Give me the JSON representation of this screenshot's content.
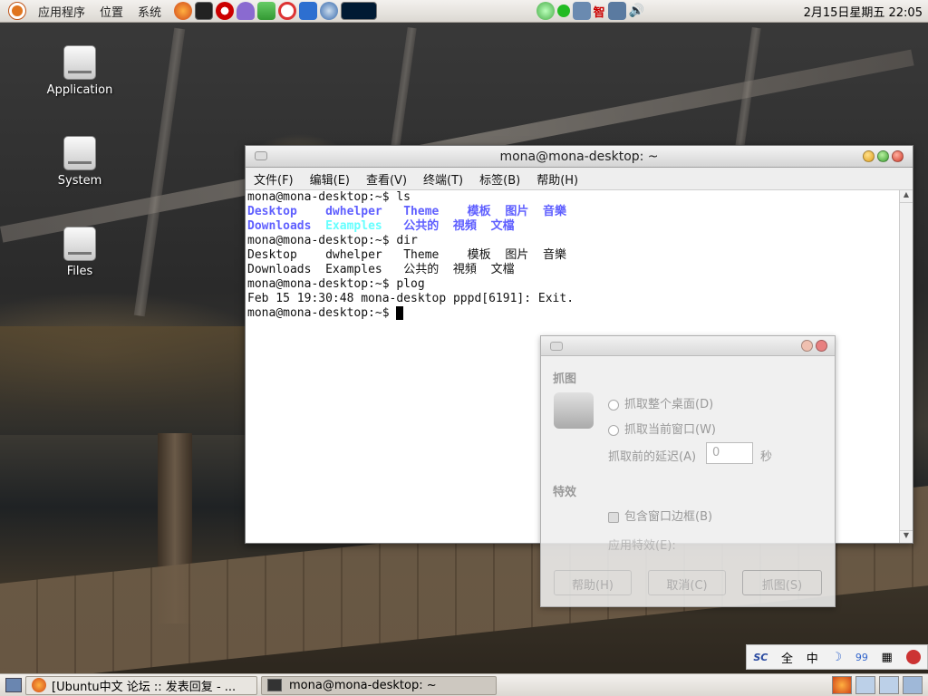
{
  "topbar": {
    "menus": [
      "应用程序",
      "位置",
      "系统"
    ],
    "clock": "2月15日星期五 22:05",
    "zhi_label": "智"
  },
  "desktop_icons": [
    "Application",
    "System",
    "Files"
  ],
  "terminal": {
    "title": "mona@mona-desktop: ~",
    "menus": [
      "文件(F)",
      "编辑(E)",
      "查看(V)",
      "终端(T)",
      "标签(B)",
      "帮助(H)"
    ],
    "lines": {
      "prompt1": "mona@mona-desktop:~$ ls",
      "ls1": [
        "Desktop",
        "dwhelper",
        "Theme",
        "模板",
        "图片",
        "音樂"
      ],
      "ls2": [
        "Downloads",
        "Examples",
        "公共的",
        "視頻",
        "文檔"
      ],
      "prompt2": "mona@mona-desktop:~$ dir",
      "dir1": [
        "Desktop",
        "dwhelper",
        "Theme",
        "模板",
        "图片",
        "音樂"
      ],
      "dir2": [
        "Downloads",
        "Examples",
        "公共的",
        "視頻",
        "文檔"
      ],
      "prompt3": "mona@mona-desktop:~$ plog",
      "log": "Feb 15 19:30:48 mona-desktop pppd[6191]: Exit.",
      "prompt4": "mona@mona-desktop:~$ "
    }
  },
  "screenshot_dialog": {
    "section_grab": "抓图",
    "opt_desktop": "抓取整个桌面(D)",
    "opt_window": "抓取当前窗口(W)",
    "delay_label": "抓取前的延迟(A)",
    "delay_value": "0",
    "delay_unit": "秒",
    "section_effects": "特效",
    "border_label": "包含窗口边框(B)",
    "apply_label": "应用特效(E):",
    "help": "帮助(H)",
    "cancel": "取消(C)",
    "grab": "抓图(S)"
  },
  "taskbar": {
    "task1": "[Ubuntu中文 论坛 :: 发表回复 - ...",
    "task2": "mona@mona-desktop: ~"
  },
  "ime": {
    "full": "全",
    "zhong": "中",
    "num": "99"
  }
}
